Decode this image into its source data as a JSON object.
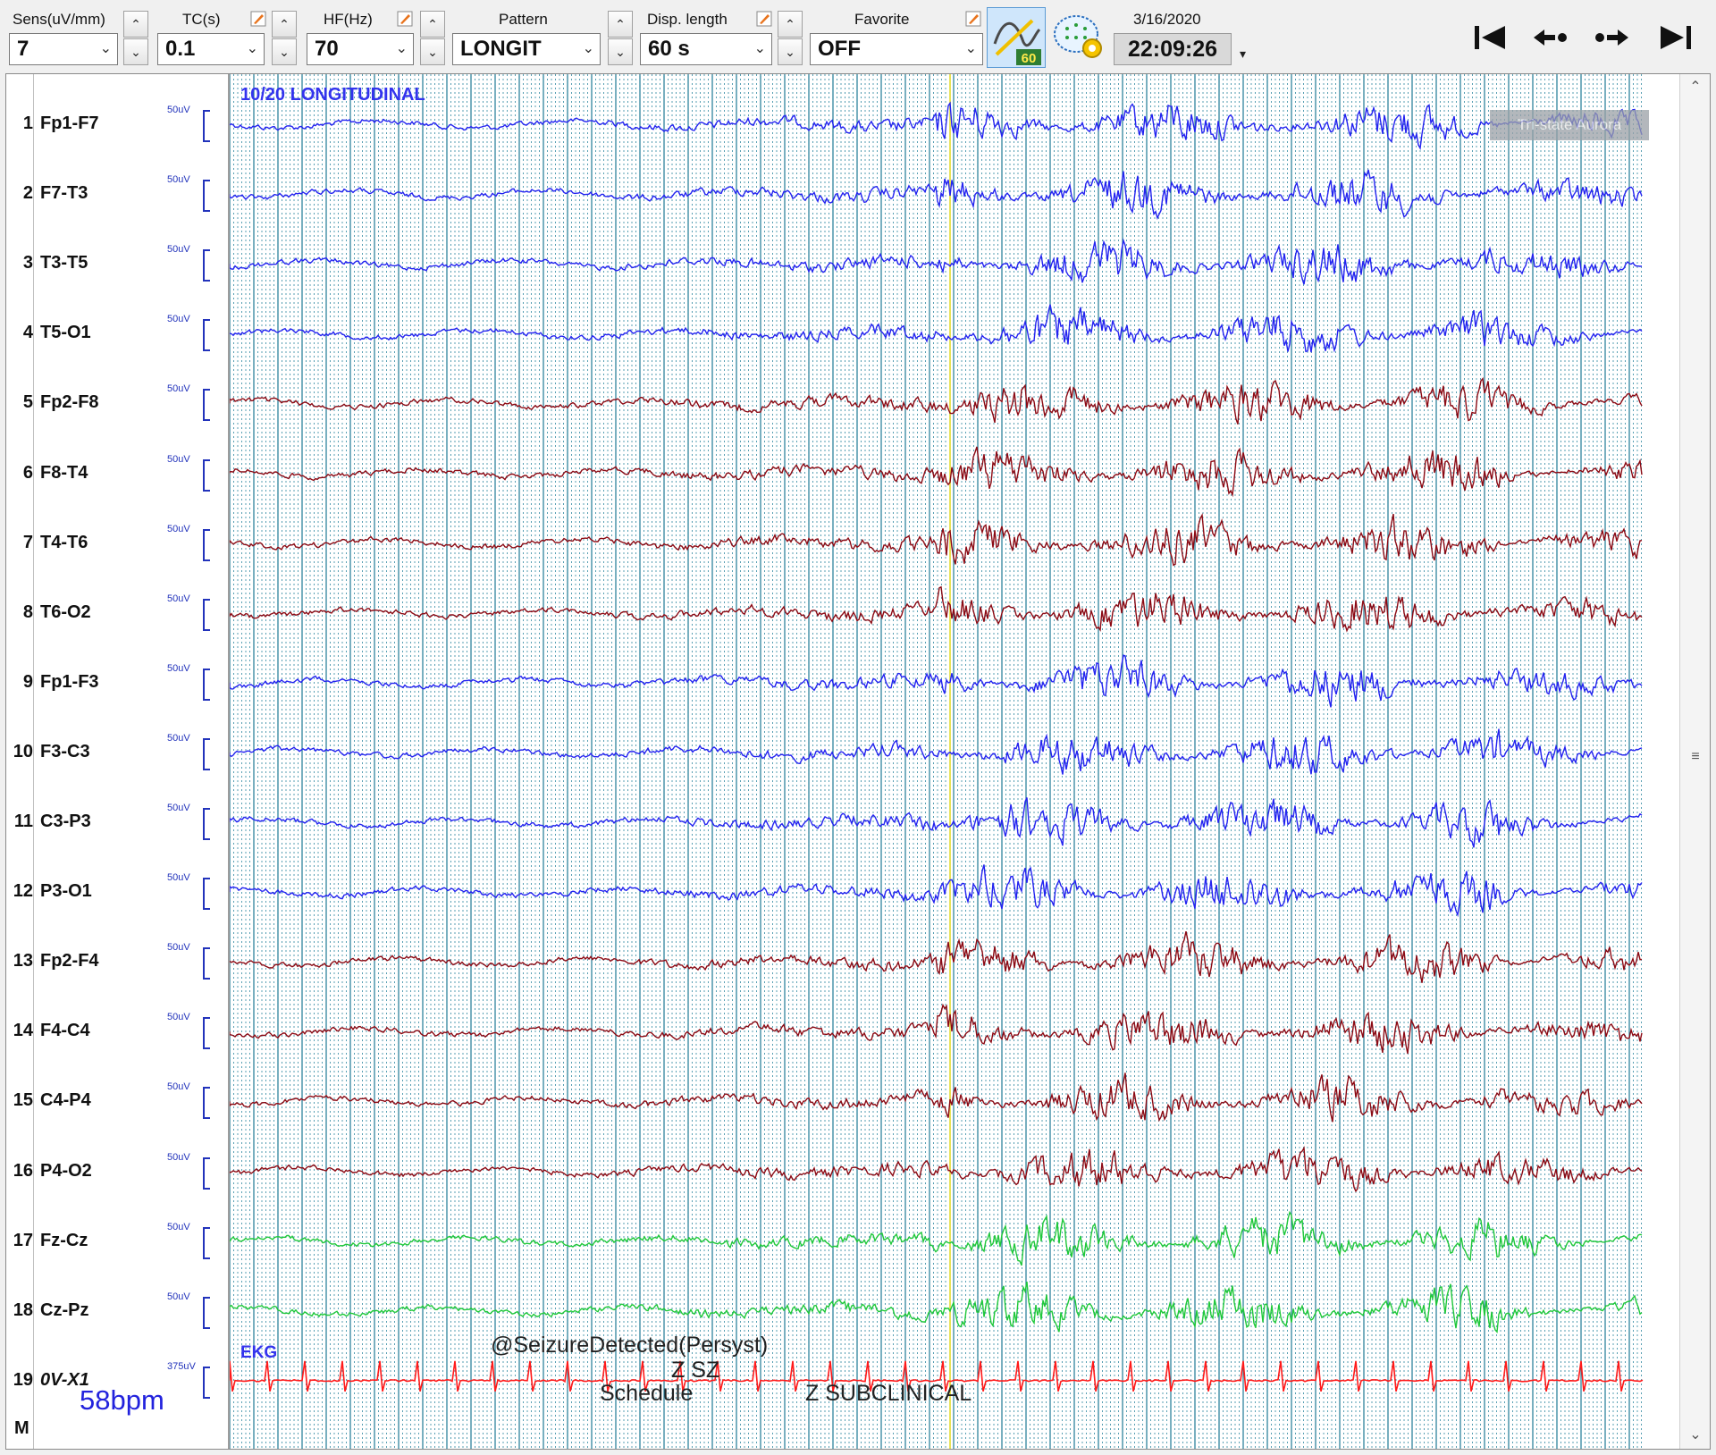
{
  "toolbar": {
    "sens": {
      "label": "Sens(uV/mm)",
      "value": "7"
    },
    "tc": {
      "label": "TC(s)",
      "value": "0.1"
    },
    "hf": {
      "label": "HF(Hz)",
      "value": "70"
    },
    "pattern": {
      "label": "Pattern",
      "value": "LONGIT"
    },
    "disp_length": {
      "label": "Disp. length",
      "value": "60 s"
    },
    "favorite": {
      "label": "Favorite",
      "value": "OFF"
    },
    "autoscale_badge": "60",
    "date": "3/16/2020",
    "time": "22:09:26"
  },
  "montage": {
    "title": "10/20 LONGITUDINAL",
    "ekg_label": "EKG",
    "heart_rate": "58bpm",
    "marker": "M",
    "watermark": "Tri-state Aurora",
    "channels": [
      {
        "num": "1",
        "name": "Fp1-F7",
        "sens": "50uV",
        "color": "#2323f0"
      },
      {
        "num": "2",
        "name": "F7-T3",
        "sens": "50uV",
        "color": "#2323f0"
      },
      {
        "num": "3",
        "name": "T3-T5",
        "sens": "50uV",
        "color": "#2323f0"
      },
      {
        "num": "4",
        "name": "T5-O1",
        "sens": "50uV",
        "color": "#2323f0"
      },
      {
        "num": "5",
        "name": "Fp2-F8",
        "sens": "50uV",
        "color": "#8b0a14"
      },
      {
        "num": "6",
        "name": "F8-T4",
        "sens": "50uV",
        "color": "#8b0a14"
      },
      {
        "num": "7",
        "name": "T4-T6",
        "sens": "50uV",
        "color": "#8b0a14"
      },
      {
        "num": "8",
        "name": "T6-O2",
        "sens": "50uV",
        "color": "#8b0a14"
      },
      {
        "num": "9",
        "name": "Fp1-F3",
        "sens": "50uV",
        "color": "#2323f0"
      },
      {
        "num": "10",
        "name": "F3-C3",
        "sens": "50uV",
        "color": "#2323f0"
      },
      {
        "num": "11",
        "name": "C3-P3",
        "sens": "50uV",
        "color": "#2323f0"
      },
      {
        "num": "12",
        "name": "P3-O1",
        "sens": "50uV",
        "color": "#2323f0"
      },
      {
        "num": "13",
        "name": "Fp2-F4",
        "sens": "50uV",
        "color": "#8b0a14"
      },
      {
        "num": "14",
        "name": "F4-C4",
        "sens": "50uV",
        "color": "#8b0a14"
      },
      {
        "num": "15",
        "name": "C4-P4",
        "sens": "50uV",
        "color": "#8b0a14"
      },
      {
        "num": "16",
        "name": "P4-O2",
        "sens": "50uV",
        "color": "#8b0a14"
      },
      {
        "num": "17",
        "name": "Fz-Cz",
        "sens": "50uV",
        "color": "#1fc83a"
      },
      {
        "num": "18",
        "name": "Cz-Pz",
        "sens": "50uV",
        "color": "#1fc83a"
      },
      {
        "num": "19",
        "name": "0V-X1",
        "sens": "375uV",
        "color": "#ff1a1a"
      }
    ],
    "annotations": {
      "seizure": "@SeizureDetected(Persyst)",
      "zsz": "Z SZ",
      "schedule": "Schedule",
      "subclinical": "Z SUBCLINICAL"
    }
  }
}
